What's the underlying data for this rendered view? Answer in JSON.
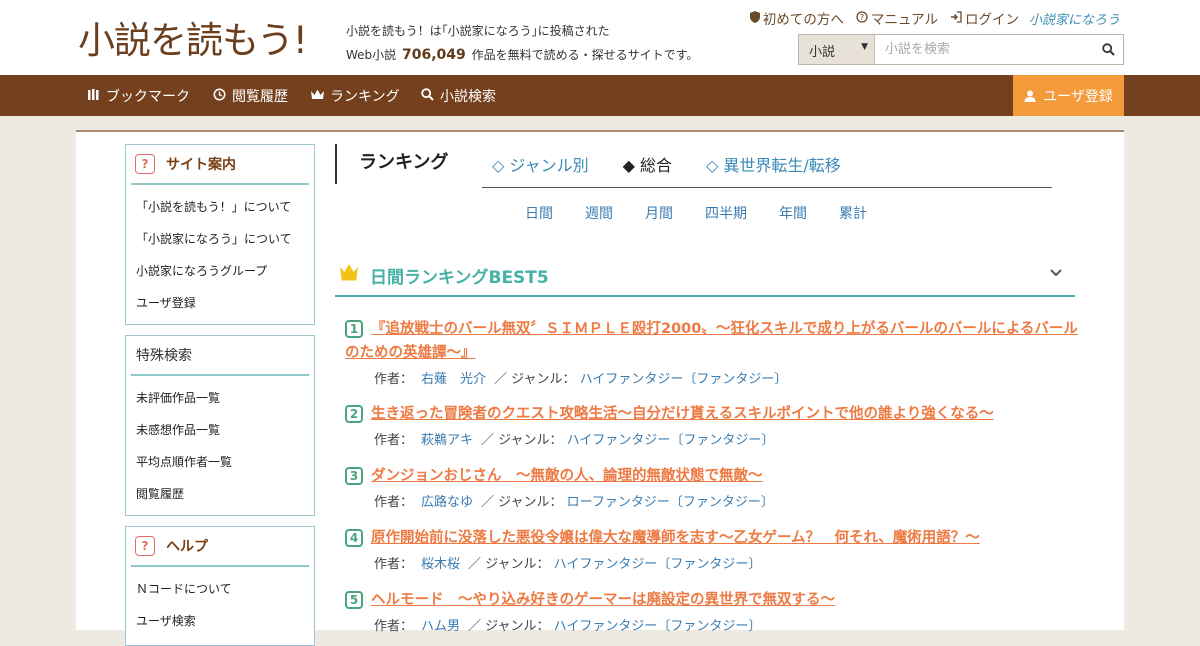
{
  "header": {
    "logo_text": "小説を読もう!",
    "tagline_line1": "小説を読もう！は｢小説家になろう｣に投稿された",
    "tagline_prefix": "Web小説",
    "work_count": "706,049",
    "tagline_suffix": "作品を無料で読める・探せるサイトです。",
    "links": [
      {
        "label": "初めての方へ",
        "icon": "shield-icon"
      },
      {
        "label": "マニュアル",
        "icon": "question-circle-icon"
      },
      {
        "label": "ログイン",
        "icon": "login-icon"
      }
    ],
    "partner_logo": "小説家になろう",
    "search": {
      "category": "小説",
      "placeholder": "小説を検索"
    }
  },
  "nav": {
    "items": [
      {
        "label": "ブックマーク",
        "icon": "bookmark-icon"
      },
      {
        "label": "閲覧履歴",
        "icon": "history-icon"
      },
      {
        "label": "ランキング",
        "icon": "crown-icon"
      },
      {
        "label": "小説検索",
        "icon": "search-icon"
      }
    ],
    "register": "ユーザ登録"
  },
  "sidebar": {
    "boxes": [
      {
        "title": "サイト案内",
        "items": [
          "「小説を読もう！」について",
          "「小説家になろう」について",
          "小説家になろうグループ",
          "ユーザ登録"
        ]
      },
      {
        "title": "特殊検索",
        "items": [
          "未評価作品一覧",
          "未感想作品一覧",
          "平均点順作者一覧",
          "閲覧履歴"
        ]
      },
      {
        "title": "ヘルプ",
        "items": [
          "Ｎコードについて",
          "ユーザ検索"
        ]
      }
    ]
  },
  "ranking": {
    "title": "ランキング",
    "tabs": [
      "◇ ジャンル別",
      "◆ 総合",
      "◇ 異世界転生/転移"
    ],
    "periods": [
      "日間",
      "週間",
      "月間",
      "四半期",
      "年間",
      "累計"
    ],
    "best_title": "日間ランキングBEST5",
    "author_label": "作者：",
    "genre_label": "／ ジャンル：",
    "entries": [
      {
        "rank": "1",
        "title": "『追放戦士のバール無双〞ＳＩＭＰＬＥ殴打2000〟～狂化スキルで成り上がるバールのバールによるバールのための英雄譚～』",
        "author": "右薙　光介",
        "genre": "ハイファンタジー〔ファンタジー〕"
      },
      {
        "rank": "2",
        "title": "生き返った冒険者のクエスト攻略生活～自分だけ貰えるスキルポイントで他の誰より強くなる～",
        "author": "萩鵜アキ",
        "genre": "ハイファンタジー〔ファンタジー〕"
      },
      {
        "rank": "3",
        "title": "ダンジョンおじさん　～無敵の人、論理的無敵状態で無敵～",
        "author": "広路なゆ",
        "genre": "ローファンタジー〔ファンタジー〕"
      },
      {
        "rank": "4",
        "title": "原作開始前に没落した悪役令嬢は偉大な魔導師を志す～乙女ゲーム？　何それ、魔術用語？～",
        "author": "桜木桜",
        "genre": "ハイファンタジー〔ファンタジー〕"
      },
      {
        "rank": "5",
        "title": "ヘルモード　～やり込み好きのゲーマーは廃設定の異世界で無双する～",
        "author": "ハム男",
        "genre": "ハイファンタジー〔ファンタジー〕"
      }
    ]
  }
}
